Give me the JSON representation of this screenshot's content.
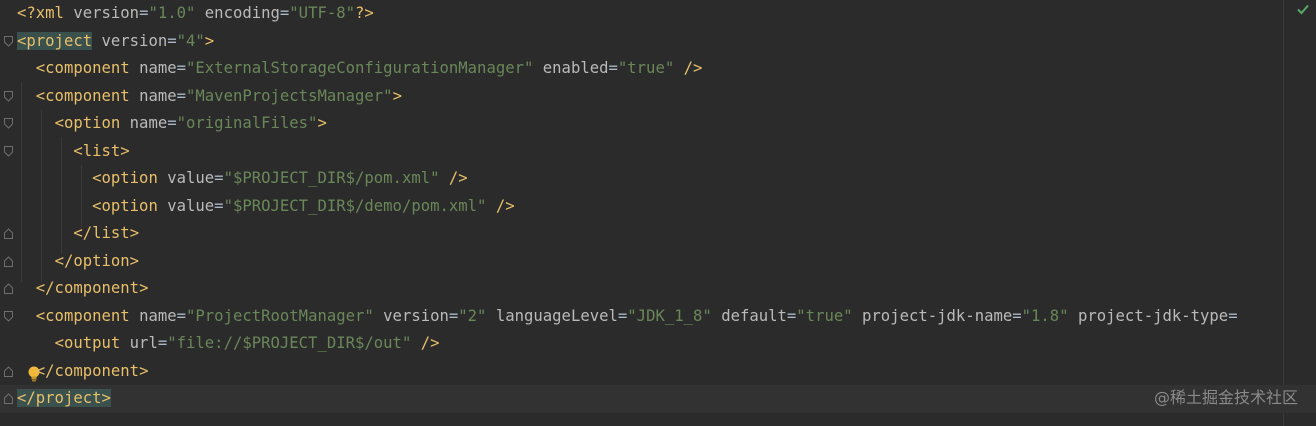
{
  "editor": {
    "lines": [
      [
        "<?xml version=\"1.0\" encoding=\"UTF-8\"?>"
      ],
      [
        "<project",
        " version=\"4\">"
      ],
      [
        "  <component name=\"ExternalStorageConfigurationManager\" enabled=\"true\" />"
      ],
      [
        "  <component name=\"MavenProjectsManager\">"
      ],
      [
        "    <option name=\"originalFiles\">"
      ],
      [
        "      <list>"
      ],
      [
        "        <option value=\"$PROJECT_DIR$/pom.xml\" />"
      ],
      [
        "        <option value=\"$PROJECT_DIR$/demo/pom.xml\" />"
      ],
      [
        "      </list>"
      ],
      [
        "    </option>"
      ],
      [
        "  </component>"
      ],
      [
        "  <component name=\"ProjectRootManager\" version=\"2\" languageLevel=\"JDK_1_8\" default=\"true\" project-jdk-name=\"1.8\" project-jdk-type="
      ],
      [
        "    <output url=\"file://$PROJECT_DIR$/out\" />"
      ],
      [
        "  </component>"
      ],
      [
        "</project>"
      ]
    ]
  },
  "status": {
    "check_icon": "check-icon",
    "color": "#59a869"
  },
  "intention": {
    "icon": "lightbulb-icon",
    "color": "#f0b73a"
  },
  "watermark": {
    "text": "@稀土掘金技术社区"
  }
}
